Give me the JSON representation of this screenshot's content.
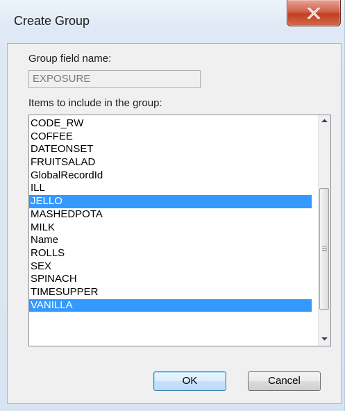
{
  "window": {
    "title": "Create Group",
    "close_icon": "close-x-icon"
  },
  "form": {
    "group_field_label": "Group field name:",
    "group_field_value": "EXPOSURE",
    "items_label": "Items to include in the group:"
  },
  "list": {
    "items": [
      {
        "label": "CODE_RW",
        "selected": false
      },
      {
        "label": "COFFEE",
        "selected": false
      },
      {
        "label": "DATEONSET",
        "selected": false
      },
      {
        "label": "FRUITSALAD",
        "selected": false
      },
      {
        "label": "GlobalRecordId",
        "selected": false
      },
      {
        "label": "ILL",
        "selected": false
      },
      {
        "label": "JELLO",
        "selected": true
      },
      {
        "label": "MASHEDPOTA",
        "selected": false
      },
      {
        "label": "MILK",
        "selected": false
      },
      {
        "label": "Name",
        "selected": false
      },
      {
        "label": "ROLLS",
        "selected": false
      },
      {
        "label": "SEX",
        "selected": false
      },
      {
        "label": "SPINACH",
        "selected": false
      },
      {
        "label": "TIMESUPPER",
        "selected": false
      },
      {
        "label": "VANILLA",
        "selected": true
      }
    ],
    "selection_color": "#3399ff"
  },
  "buttons": {
    "ok_label": "OK",
    "cancel_label": "Cancel"
  }
}
